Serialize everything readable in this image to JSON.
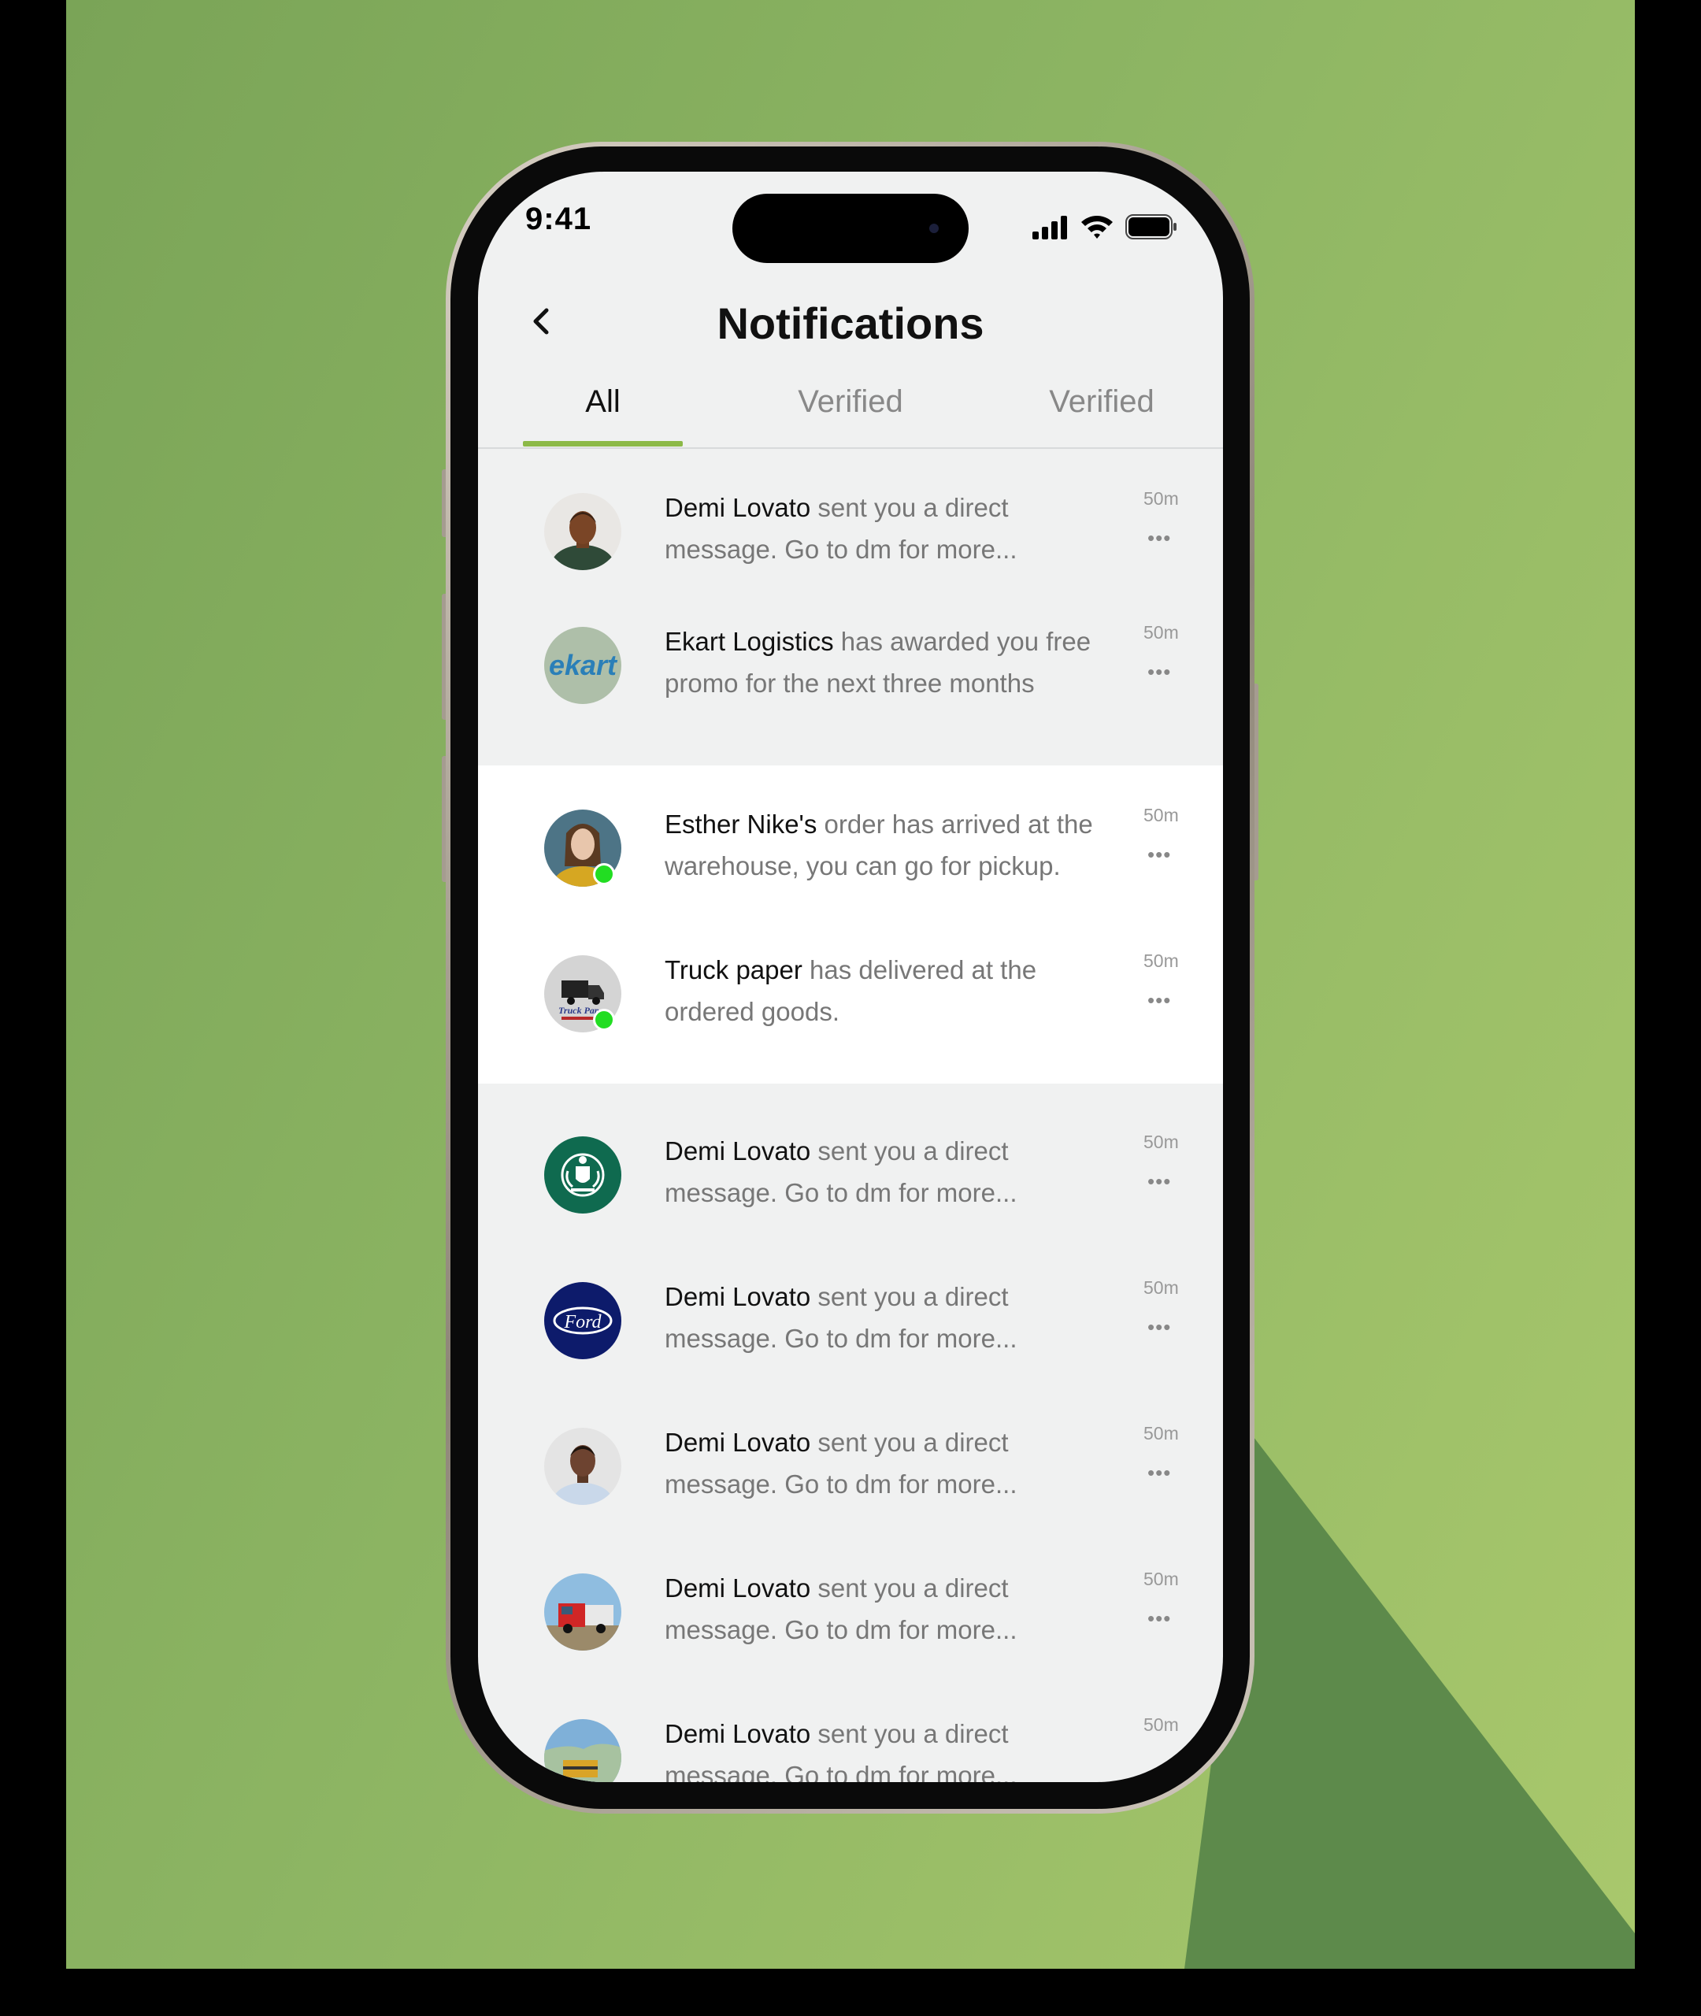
{
  "status": {
    "time": "9:41"
  },
  "header": {
    "title": "Notifications"
  },
  "tabs": [
    {
      "label": "All",
      "active": true
    },
    {
      "label": "Verified",
      "active": false
    },
    {
      "label": "Verified",
      "active": false
    }
  ],
  "notifications": [
    {
      "name": "Demi Lovato",
      "text": " sent you a direct message. Go to dm for more...",
      "time": "50m",
      "avatar": "person-avatar",
      "online": false
    },
    {
      "name": "Ekart Logistics",
      "text": " has awarded you free promo for the next three months",
      "time": "50m",
      "avatar": "ekart-logo",
      "logo_text": "ekart",
      "online": false
    },
    {
      "name": "Esther Nike's",
      "text": " order has arrived at the warehouse, you can go for pickup.",
      "time": "50m",
      "avatar": "person-avatar",
      "online": true
    },
    {
      "name": "Truck paper",
      "text": "  has delivered at the ordered goods.",
      "time": "50m",
      "avatar": "truck-paper-logo",
      "logo_text": "Truck Paper",
      "online": true
    },
    {
      "name": "Demi Lovato",
      "text": " sent you a direct message. Go to dm for more...",
      "time": "50m",
      "avatar": "crest-logo",
      "online": false
    },
    {
      "name": "Demi Lovato",
      "text": " sent you a direct message. Go to dm for more...",
      "time": "50m",
      "avatar": "ford-logo",
      "logo_text": "Ford",
      "online": false
    },
    {
      "name": "Demi Lovato",
      "text": " sent you a direct message. Go to dm for more...",
      "time": "50m",
      "avatar": "person-avatar",
      "online": false
    },
    {
      "name": "Demi Lovato",
      "text": " sent you a direct message. Go to dm for more...",
      "time": "50m",
      "avatar": "truck-photo",
      "online": false
    },
    {
      "name": "Demi Lovato",
      "text": " sent you a direct message. Go to dm for more...",
      "time": "50m",
      "avatar": "truck-photo",
      "online": false
    }
  ],
  "more_label": "•••",
  "colors": {
    "accent": "#8cb948",
    "online": "#22dd22",
    "background_green": "#8db563"
  }
}
